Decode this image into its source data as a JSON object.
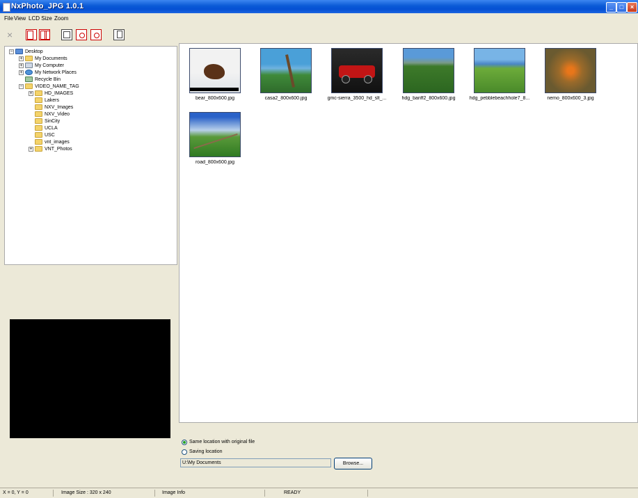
{
  "app": {
    "title": "NxPhoto_JPG 1.0.1"
  },
  "menu": [
    "File",
    "View",
    "LCD Size",
    "Zoom"
  ],
  "tree": [
    {
      "label": "Desktop",
      "icon": "desktop-icon",
      "kind": "desk",
      "exp": "−"
    },
    {
      "label": "My Documents",
      "icon": "folder-icon",
      "kind": "folder",
      "exp": "+"
    },
    {
      "label": "My Computer",
      "icon": "computer-icon",
      "kind": "comp",
      "exp": "+"
    },
    {
      "label": "My Network Places",
      "icon": "network-icon",
      "kind": "net",
      "exp": "+"
    },
    {
      "label": "Recycle Bin",
      "icon": "recycle-bin-icon",
      "kind": "bin",
      "exp": ""
    },
    {
      "label": "VIDEO_NAME_TAG",
      "icon": "folder-icon",
      "kind": "folder",
      "exp": "−"
    },
    {
      "label": "HD_IMAGES",
      "icon": "folder-icon",
      "kind": "folder",
      "exp": "+"
    },
    {
      "label": "Lakers",
      "icon": "folder-icon",
      "kind": "folder",
      "exp": ""
    },
    {
      "label": "NXV_Images",
      "icon": "folder-icon",
      "kind": "folder",
      "exp": ""
    },
    {
      "label": "NXV_Video",
      "icon": "folder-icon",
      "kind": "folder",
      "exp": ""
    },
    {
      "label": "SinCity",
      "icon": "folder-icon",
      "kind": "folder",
      "exp": ""
    },
    {
      "label": "UCLA",
      "icon": "folder-icon",
      "kind": "folder",
      "exp": ""
    },
    {
      "label": "USC",
      "icon": "folder-icon",
      "kind": "folder",
      "exp": ""
    },
    {
      "label": "vnt_images",
      "icon": "folder-icon",
      "kind": "folder",
      "exp": ""
    },
    {
      "label": "VNT_Photos",
      "icon": "folder-icon",
      "kind": "folder",
      "exp": "+"
    }
  ],
  "thumbnails": [
    {
      "label": "bear_800x600.jpg",
      "scene": "snow-animal"
    },
    {
      "label": "casa2_800x600.jpg",
      "scene": "palm-coast"
    },
    {
      "label": "gmc-sierra_3500_hd_slt_...",
      "scene": "red-truck"
    },
    {
      "label": "hdg_banff2_800x600.jpg",
      "scene": "mountain-green"
    },
    {
      "label": "hdg_pebblebeachhole7_8...",
      "scene": "golf-coast"
    },
    {
      "label": "nemo_800x600_3.jpg",
      "scene": "clownfish"
    },
    {
      "label": "road_800x600.jpg",
      "scene": "fence-road"
    }
  ],
  "save_options": {
    "same_location": "Same location with original file",
    "saving_location": "Saving location",
    "path": "U:\\My Documents",
    "browse": "Browse..."
  },
  "status": {
    "coords": "X = 0, Y = 0",
    "image_size": "Image Size : 320 x 240",
    "image_info": "Image Info",
    "state": "READY"
  }
}
